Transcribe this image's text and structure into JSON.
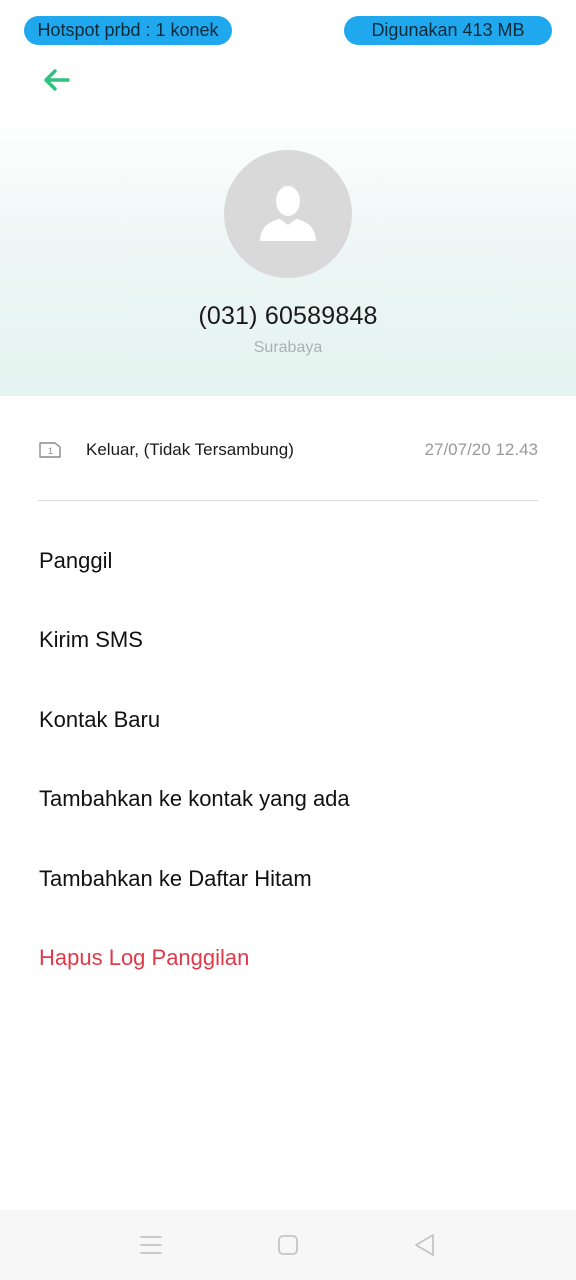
{
  "status_bar": {
    "hotspot": "Hotspot prbd : 1 konek",
    "data_usage": "Digunakan 413 MB"
  },
  "header": {
    "back_icon": "arrow-left-icon",
    "avatar_icon": "person-placeholder-icon",
    "phone_number": "(031) 60589848",
    "location": "Surabaya"
  },
  "call_log": {
    "sim_label": "1",
    "type": "Keluar, (Tidak Tersambung)",
    "time": "27/07/20 12.43"
  },
  "actions": [
    {
      "label": "Panggil"
    },
    {
      "label": "Kirim SMS"
    },
    {
      "label": "Kontak Baru"
    },
    {
      "label": "Tambahkan ke kontak yang ada"
    },
    {
      "label": "Tambahkan ke Daftar Hitam"
    },
    {
      "label": "Hapus Log Panggilan"
    }
  ],
  "colors": {
    "accent": "#2ec27e",
    "pill": "#1fa8ee",
    "danger": "#e0394a"
  },
  "nav": {
    "menu_icon": "menu-icon",
    "home_icon": "home-icon",
    "back_icon": "back-triangle-icon"
  }
}
